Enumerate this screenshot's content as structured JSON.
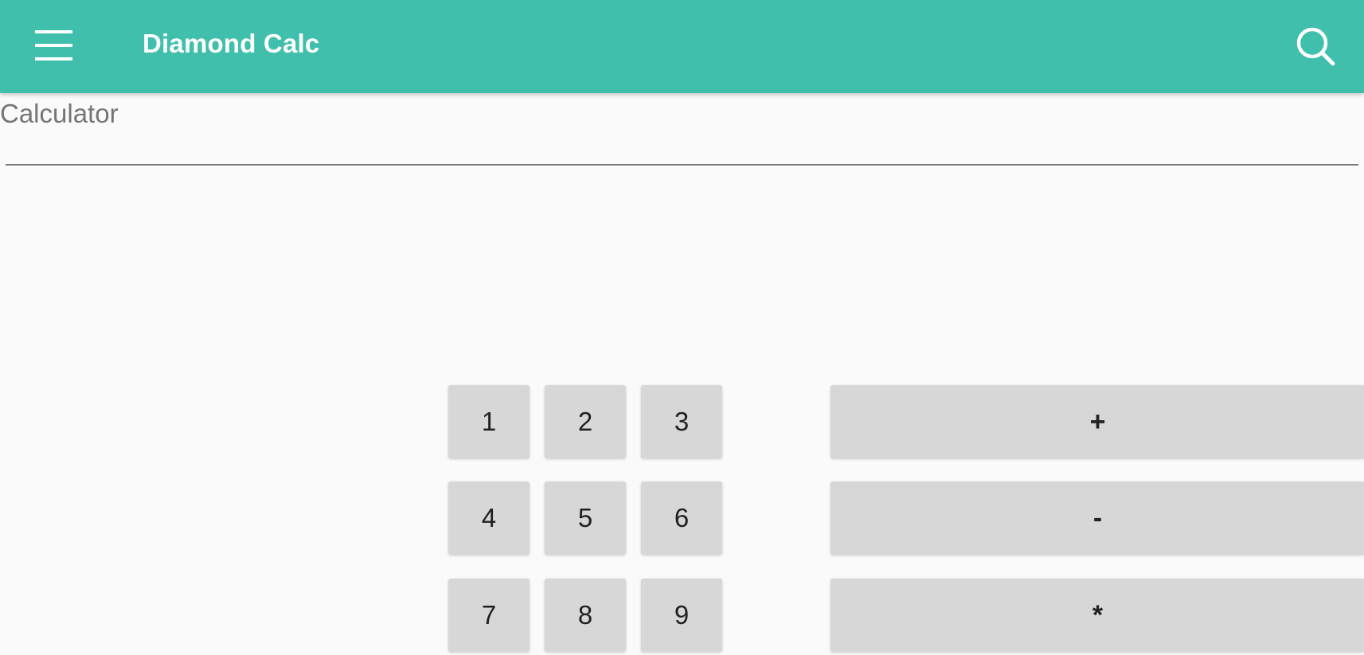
{
  "app": {
    "title": "Diamond Calc",
    "accent_color": "#3fbfac"
  },
  "toolbar": {
    "menu_icon": "hamburger-menu-icon",
    "search_icon": "search-icon"
  },
  "calculator": {
    "label": "Calculator",
    "input_value": "",
    "number_keys": [
      [
        "1",
        "2",
        "3"
      ],
      [
        "4",
        "5",
        "6"
      ],
      [
        "7",
        "8",
        "9"
      ]
    ],
    "operator_keys": [
      "+",
      "-",
      "*"
    ]
  }
}
